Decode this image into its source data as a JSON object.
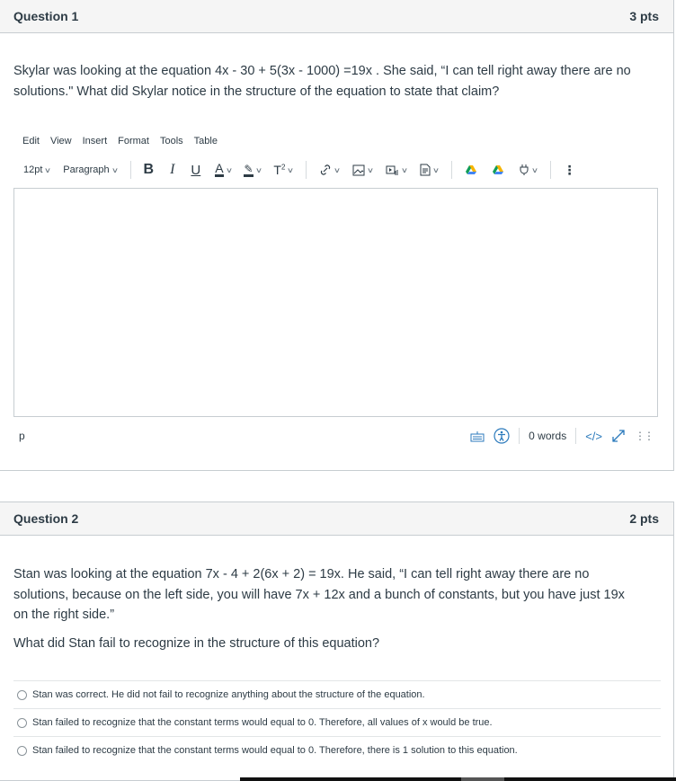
{
  "questions": [
    {
      "title": "Question 1",
      "points": "3 pts",
      "text": "Skylar was looking at the equation 4x - 30 + 5(3x - 1000) =19x . She said, “I can tell right away there are no solutions.\" What did Skylar notice in the structure of the equation to state that claim?",
      "editor": {
        "menu": [
          "Edit",
          "View",
          "Insert",
          "Format",
          "Tools",
          "Table"
        ],
        "font_size": "12pt",
        "block_format": "Paragraph",
        "toolbar_icons": [
          "bold-icon",
          "italic-icon",
          "underline-icon",
          "text-color-icon",
          "highlight-icon",
          "superscript-icon",
          "link-icon",
          "image-icon",
          "media-icon",
          "document-icon",
          "google-drive-icon",
          "google-drive-icon-2",
          "plugin-icon",
          "more-icon"
        ],
        "content": "",
        "path": "p",
        "word_count": "0 words",
        "html_toggle": "</>"
      }
    },
    {
      "title": "Question 2",
      "points": "2 pts",
      "text": "Stan was looking at the equation 7x - 4 + 2(6x + 2) = 19x. He said, “I can tell right away there are no solutions, because on the left side, you will have 7x + 12x  and a bunch of constants, but you have just 19x on the right side.”",
      "prompt": "What did Stan fail to recognize in the structure of this equation?",
      "answers": [
        "Stan was correct. He did not fail to recognize anything about the structure of the equation.",
        "Stan failed to recognize that the constant terms would equal to 0. Therefore, all values of x would be true.",
        "Stan failed to recognize that the constant terms would equal to 0. Therefore, there is 1 solution to this equation."
      ]
    }
  ],
  "colors": {
    "header_bg": "#f5f5f5",
    "text": "#2d3b45",
    "icon_blue": "#2b7abc",
    "border": "#c7cdd1"
  }
}
